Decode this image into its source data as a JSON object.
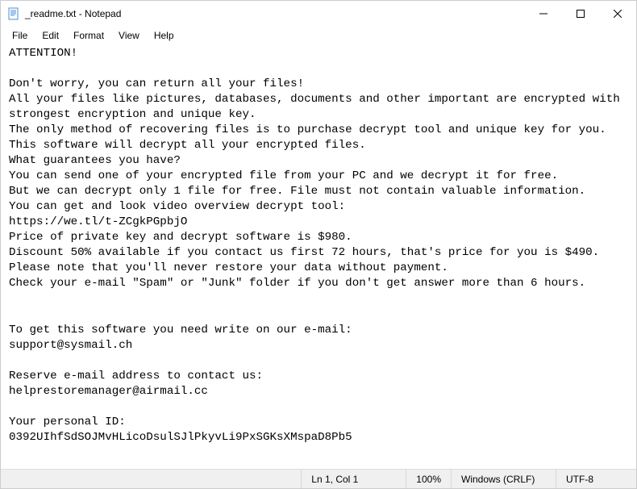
{
  "window": {
    "title": "_readme.txt - Notepad"
  },
  "menubar": {
    "items": [
      "File",
      "Edit",
      "Format",
      "View",
      "Help"
    ]
  },
  "content": {
    "text": "ATTENTION!\n\nDon't worry, you can return all your files!\nAll your files like pictures, databases, documents and other important are encrypted with strongest encryption and unique key.\nThe only method of recovering files is to purchase decrypt tool and unique key for you.\nThis software will decrypt all your encrypted files.\nWhat guarantees you have?\nYou can send one of your encrypted file from your PC and we decrypt it for free.\nBut we can decrypt only 1 file for free. File must not contain valuable information.\nYou can get and look video overview decrypt tool:\nhttps://we.tl/t-ZCgkPGpbjO\nPrice of private key and decrypt software is $980.\nDiscount 50% available if you contact us first 72 hours, that's price for you is $490.\nPlease note that you'll never restore your data without payment.\nCheck your e-mail \"Spam\" or \"Junk\" folder if you don't get answer more than 6 hours.\n\n\nTo get this software you need write on our e-mail:\nsupport@sysmail.ch\n\nReserve e-mail address to contact us:\nhelprestoremanager@airmail.cc\n\nYour personal ID:\n0392UIhfSdSOJMvHLicoDsulSJlPkyvLi9PxSGKsXMspaD8Pb5"
  },
  "statusbar": {
    "position": "Ln 1, Col 1",
    "zoom": "100%",
    "line_ending": "Windows (CRLF)",
    "encoding": "UTF-8"
  }
}
